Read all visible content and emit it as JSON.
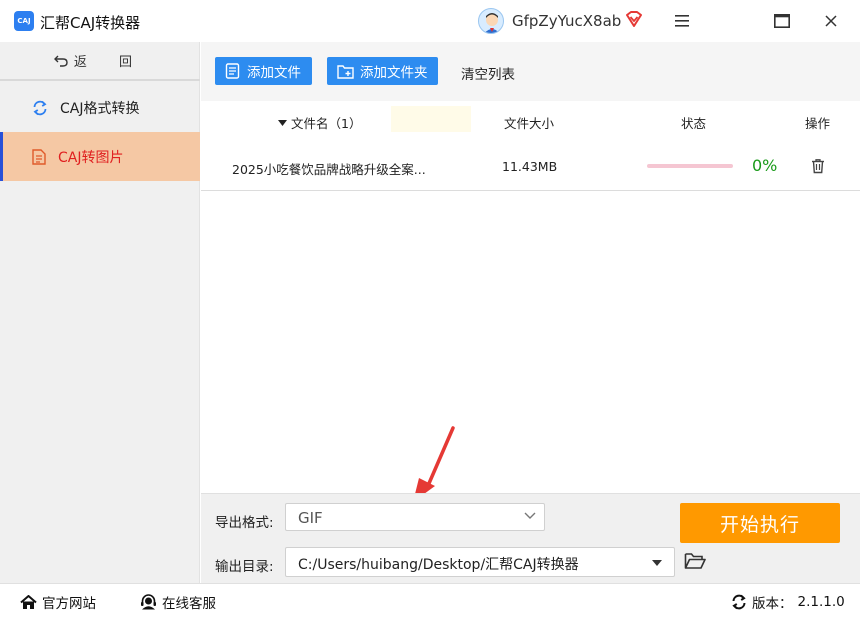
{
  "app": {
    "logo_text": "CAJ",
    "title": "汇帮CAJ转换器",
    "username": "GfpZyYucX8ab"
  },
  "sidebar": {
    "back_label": "返 回",
    "items": [
      {
        "label": "CAJ格式转换",
        "icon": "refresh-icon",
        "active": false
      },
      {
        "label": "CAJ转图片",
        "icon": "document-icon",
        "active": true
      }
    ]
  },
  "toolbar": {
    "add_file": "添加文件",
    "add_folder": "添加文件夹",
    "clear_list": "清空列表"
  },
  "table": {
    "headers": {
      "name": "文件名（1）",
      "size": "文件大小",
      "status": "状态",
      "op": "操作"
    },
    "rows": [
      {
        "name": "2025小吃餐饮品牌战略升级全案...",
        "size": "11.43MB",
        "progress": 0,
        "percent": "0%"
      }
    ]
  },
  "settings": {
    "format_label": "导出格式:",
    "format_value": "GIF",
    "dir_label": "输出目录:",
    "dir_value": "C:/Users/huibang/Desktop/汇帮CAJ转换器",
    "start_label": "开始执行"
  },
  "statusbar": {
    "website": "官方网站",
    "service": "在线客服",
    "version_label": "版本：",
    "version": "2.1.1.0"
  },
  "colors": {
    "primary": "#2d8cf0",
    "accent_orange": "#ff9900",
    "active_nav_bg": "#f5c8a4",
    "active_nav_text": "#e02020",
    "progress_green": "#1a9a1a",
    "annotation_red": "#e53935"
  }
}
